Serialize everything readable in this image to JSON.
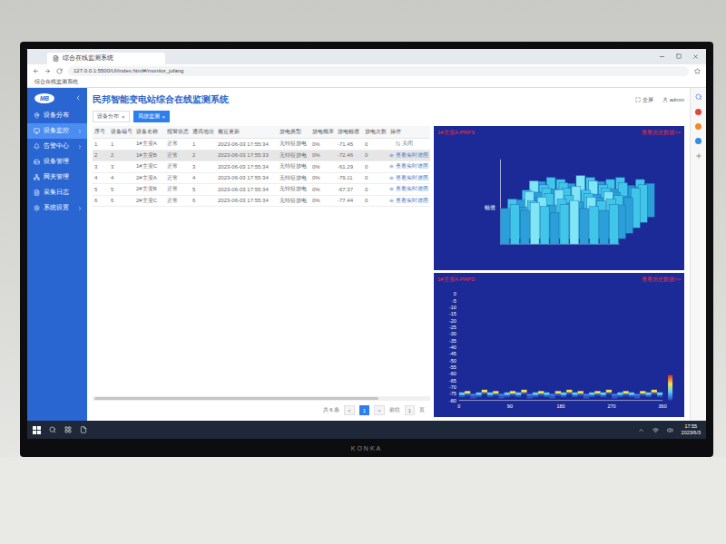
{
  "monitor": {
    "brand": "KONKA"
  },
  "browser": {
    "tab_title": "综合在线监测系统",
    "url": "127.0.0.1:5500/UI/index.html#/monitor_jufang",
    "bookmarks": [
      "综合在线监测系统"
    ]
  },
  "app": {
    "logo": "MB",
    "title": "民邦智能变电站综合在线监测系统",
    "header_actions": [
      "全屏",
      "admin"
    ]
  },
  "sidebar": {
    "items": [
      {
        "label": "设备分布",
        "selected": false,
        "expandable": false
      },
      {
        "label": "设备监控",
        "selected": true,
        "expandable": true
      },
      {
        "label": "告警中心",
        "selected": false,
        "expandable": true
      },
      {
        "label": "设备管理",
        "selected": false,
        "expandable": false
      },
      {
        "label": "网关管理",
        "selected": false,
        "expandable": false
      },
      {
        "label": "采集日志",
        "selected": false,
        "expandable": false
      },
      {
        "label": "系统设置",
        "selected": false,
        "expandable": true
      }
    ]
  },
  "breadcrumbs": [
    {
      "label": "设备分布",
      "close": "×",
      "selected": false
    },
    {
      "label": "局放监测",
      "close": "×",
      "selected": true
    }
  ],
  "table": {
    "columns": [
      "序号",
      "设备编号",
      "设备名称",
      "报警状态",
      "通讯地址",
      "最近更新",
      "放电类型",
      "放电概率",
      "放电幅值",
      "放电次数",
      "操作"
    ],
    "rows": [
      {
        "cells": [
          "1",
          "1",
          "1#主变A",
          "正常",
          "1",
          "2023-06-03 17:55:34",
          "无特征放电",
          "0%",
          "-71.45",
          "0"
        ],
        "action": {
          "label": "关闭",
          "kind": "close"
        },
        "selected": false
      },
      {
        "cells": [
          "2",
          "2",
          "1#主变B",
          "正常",
          "2",
          "2023-06-03 17:55:33",
          "无特征放电",
          "0%",
          "-72.46",
          "0"
        ],
        "action": {
          "label": "查看实时谱图",
          "kind": "view"
        },
        "selected": true
      },
      {
        "cells": [
          "3",
          "3",
          "1#主变C",
          "正常",
          "3",
          "2023-06-03 17:55:34",
          "无特征放电",
          "0%",
          "-61.29",
          "0"
        ],
        "action": {
          "label": "查看实时谱图",
          "kind": "view"
        },
        "selected": false
      },
      {
        "cells": [
          "4",
          "4",
          "2#主变A",
          "正常",
          "4",
          "2023-06-03 17:55:34",
          "无特征放电",
          "0%",
          "-79.11",
          "0"
        ],
        "action": {
          "label": "查看实时谱图",
          "kind": "view"
        },
        "selected": false
      },
      {
        "cells": [
          "5",
          "5",
          "2#主变B",
          "正常",
          "5",
          "2023-06-03 17:55:34",
          "无特征放电",
          "0%",
          "-67.37",
          "0"
        ],
        "action": {
          "label": "查看实时谱图",
          "kind": "view"
        },
        "selected": false
      },
      {
        "cells": [
          "6",
          "6",
          "2#主变C",
          "正常",
          "6",
          "2023-06-03 17:55:34",
          "无特征放电",
          "0%",
          "-77.44",
          "0"
        ],
        "action": {
          "label": "查看实时谱图",
          "kind": "view"
        },
        "selected": false
      }
    ]
  },
  "pagination": {
    "total": "共 6 条",
    "prev": "<",
    "page": "1",
    "next": ">",
    "goto": "前往",
    "goto_value": "1",
    "unit": "页"
  },
  "charts": {
    "prps": {
      "title": "1#主变A-PRPS",
      "link": "查看历史数据>>",
      "axis_label": "幅值",
      "rows": [
        [
          -72,
          -70,
          -73,
          -69,
          -71,
          -74,
          -70,
          -68,
          -72,
          -71,
          -73,
          -70
        ],
        [
          -70,
          -74,
          -71,
          -69,
          -73,
          -70,
          -72,
          -75,
          -69,
          -71,
          -70,
          -73
        ],
        [
          -73,
          -69,
          -72,
          -70,
          -68,
          -71,
          -74,
          -70,
          -72,
          -69,
          -71,
          -72
        ],
        [
          -71,
          -72,
          -70,
          -74,
          -70,
          -69,
          -71,
          -73,
          -70,
          -72,
          -74,
          -70
        ],
        [
          -69,
          -71,
          -73,
          -70,
          -72,
          -74,
          -69,
          -71,
          -73,
          -70,
          -72,
          -71
        ],
        [
          -72,
          -70,
          -71,
          -73,
          -69,
          -70,
          -72,
          -71,
          -70,
          -74,
          -71,
          -73
        ]
      ]
    },
    "prpd": {
      "title": "1#主变A-PRPD",
      "link": "查看历史数据>>",
      "x_ticks": [
        "0",
        "90",
        "180",
        "270",
        "360"
      ],
      "y_ticks": [
        "0",
        "-5",
        "-10",
        "-15",
        "-20",
        "-25",
        "-30",
        "-35",
        "-40",
        "-45",
        "-50",
        "-55",
        "-60",
        "-65",
        "-70",
        "-75",
        "-80"
      ],
      "points": [
        -75,
        -74,
        -76,
        -75,
        -73,
        -75,
        -74,
        -76,
        -75,
        -74,
        -75,
        -73,
        -76,
        -75,
        -74,
        -75,
        -76,
        -74,
        -75,
        -73,
        -75,
        -74,
        -76,
        -75,
        -74,
        -75,
        -73,
        -76,
        -75,
        -74,
        -75,
        -76,
        -74,
        -75,
        -73,
        -75
      ]
    }
  },
  "taskbar": {
    "time": "17:55",
    "date": "2023/6/3"
  }
}
